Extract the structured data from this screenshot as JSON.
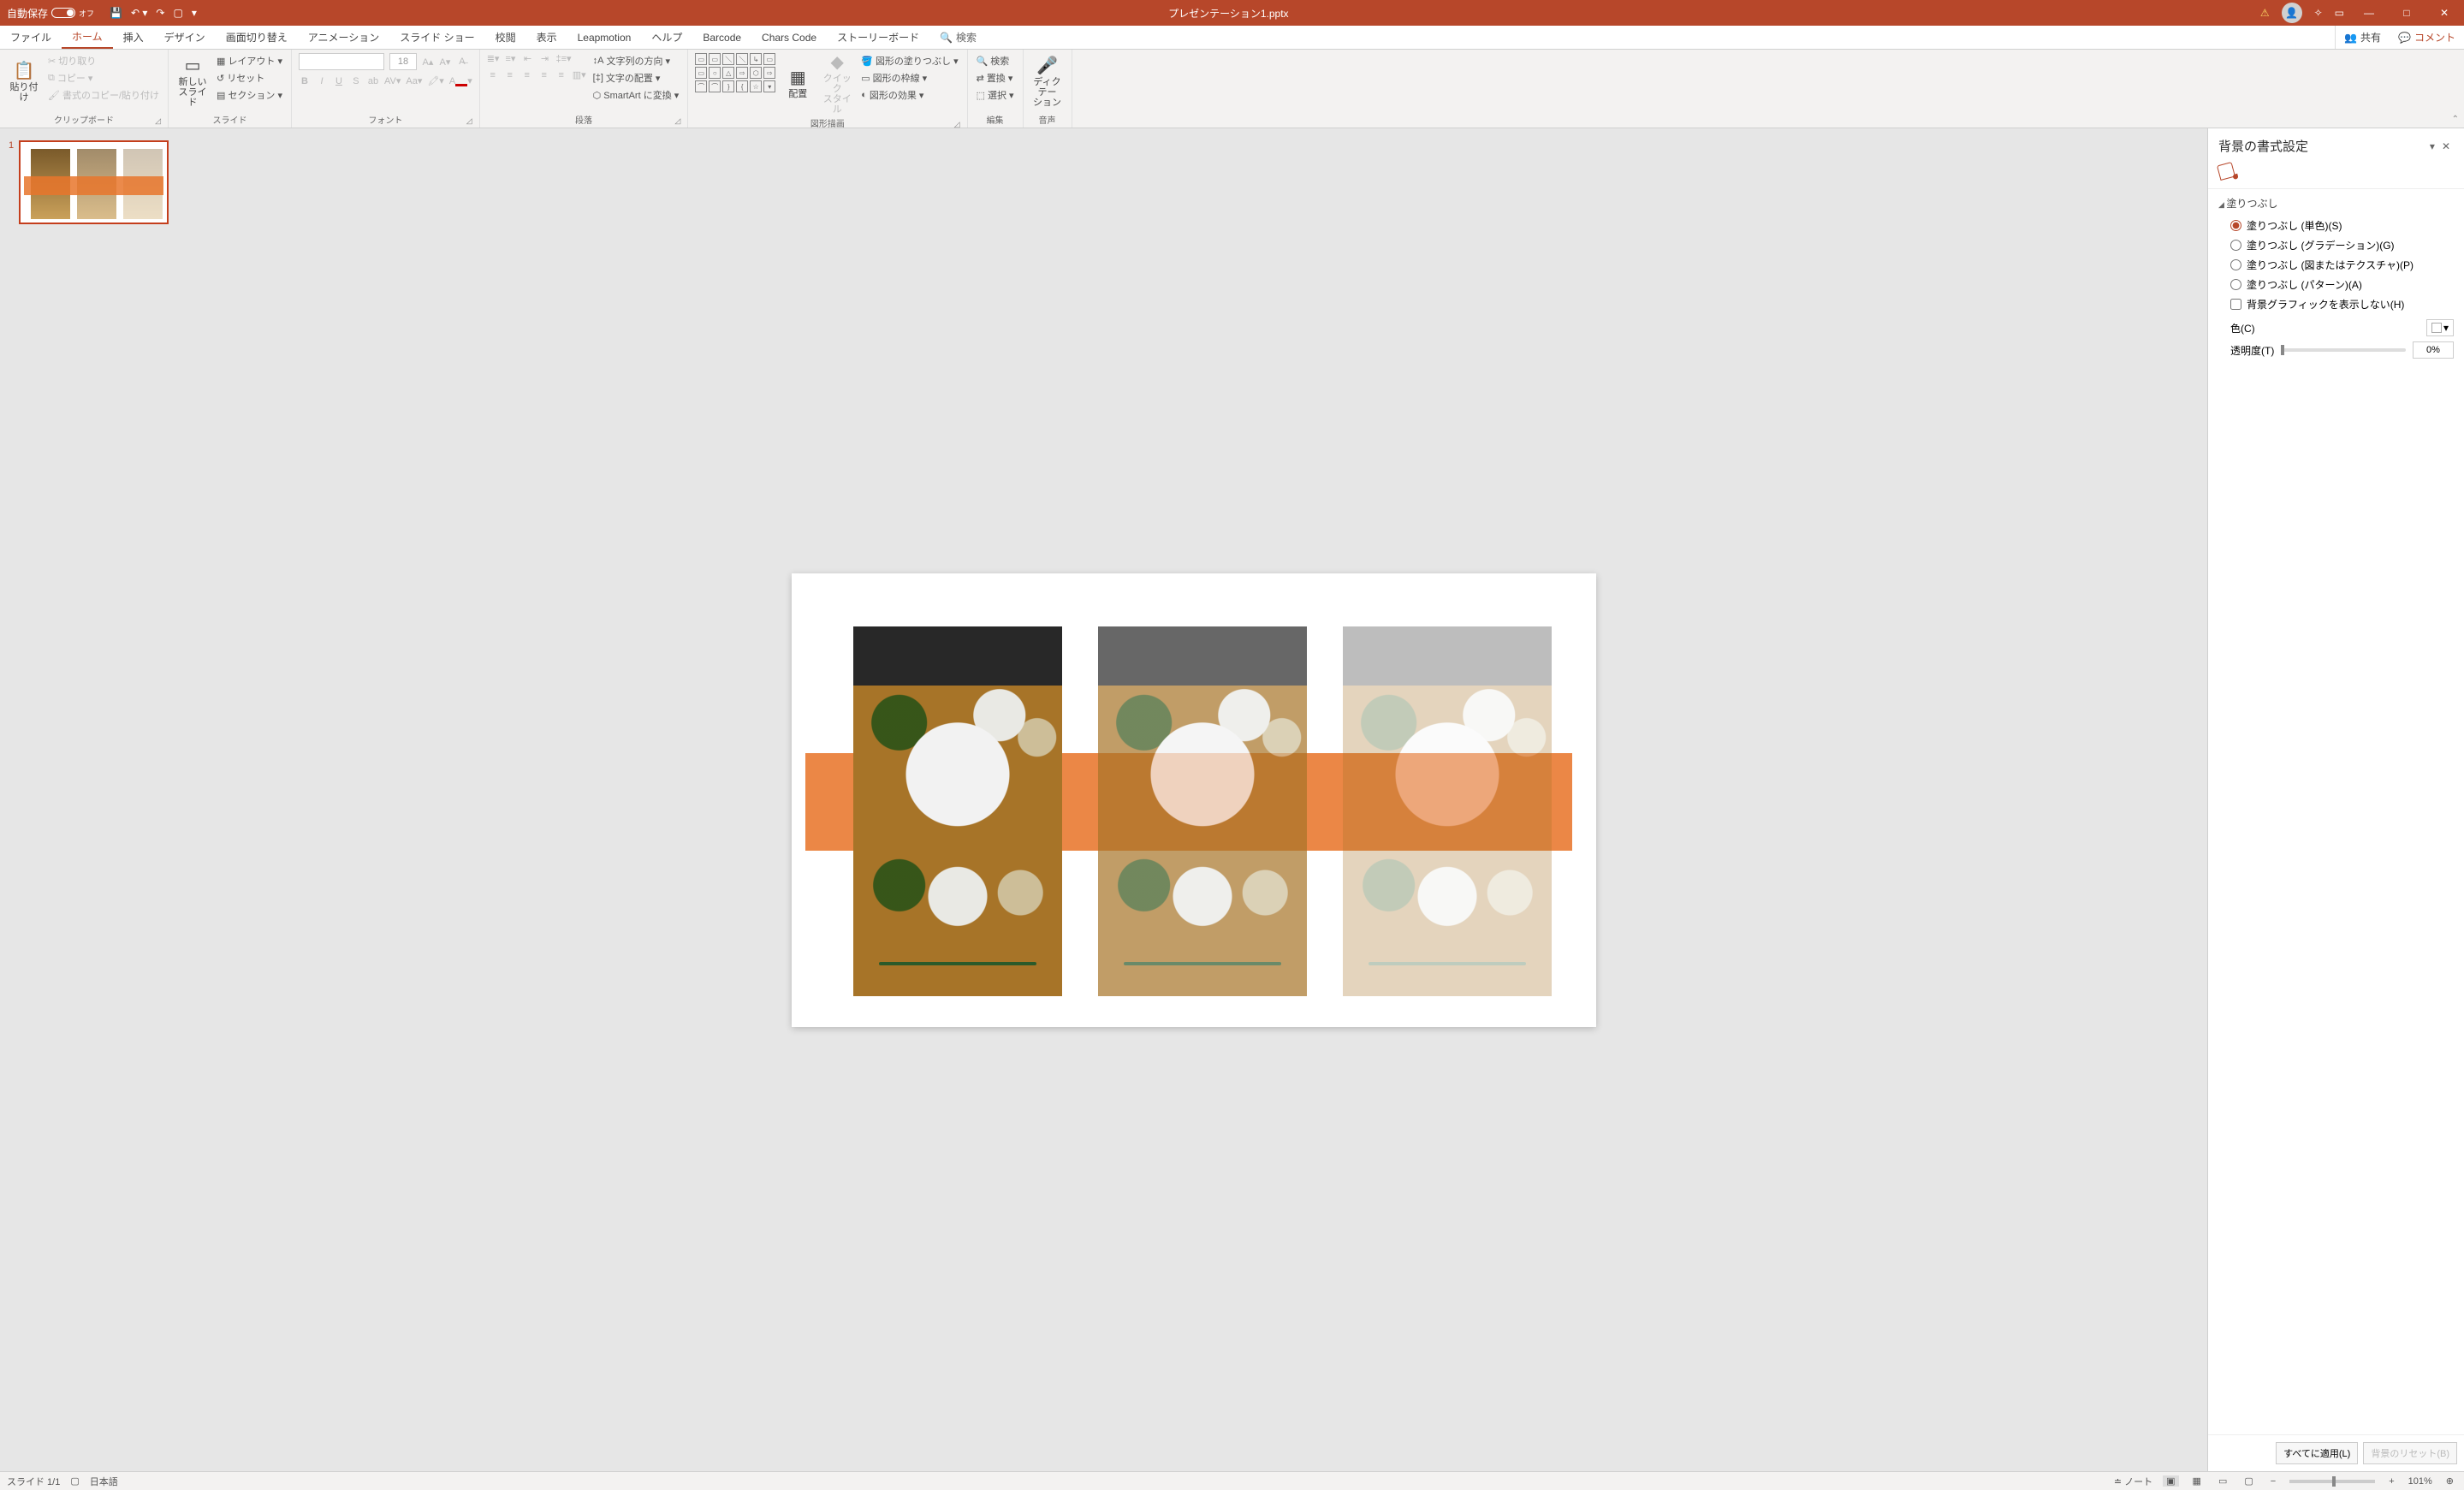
{
  "title_bar": {
    "autosave_label": "自動保存",
    "autosave_state": "オフ",
    "document_title": "プレゼンテーション1.pptx"
  },
  "tabs": {
    "file": "ファイル",
    "home": "ホーム",
    "insert": "挿入",
    "design": "デザイン",
    "transitions": "画面切り替え",
    "animations": "アニメーション",
    "slideshow": "スライド ショー",
    "review": "校閲",
    "view": "表示",
    "leapmotion": "Leapmotion",
    "help": "ヘルプ",
    "barcode": "Barcode",
    "charscode": "Chars Code",
    "storyboard": "ストーリーボード",
    "search": "検索",
    "share": "共有",
    "comment": "コメント"
  },
  "ribbon": {
    "clipboard": {
      "paste": "貼り付け",
      "cut": "切り取り",
      "copy": "コピー",
      "format_painter": "書式のコピー/貼り付け",
      "label": "クリップボード"
    },
    "slides": {
      "new_slide": "新しい\nスライド",
      "layout": "レイアウト",
      "reset": "リセット",
      "section": "セクション",
      "label": "スライド"
    },
    "font": {
      "size": "18",
      "label": "フォント"
    },
    "paragraph": {
      "text_direction": "文字列の方向",
      "text_align": "文字の配置",
      "smartart": "SmartArt に変換",
      "label": "段落"
    },
    "drawing": {
      "arrange": "配置",
      "quick_styles": "クイック\nスタイル",
      "shape_fill": "図形の塗りつぶし",
      "shape_outline": "図形の枠線",
      "shape_effects": "図形の効果",
      "label": "図形描画"
    },
    "editing": {
      "find": "検索",
      "replace": "置換",
      "select": "選択",
      "label": "編集"
    },
    "voice": {
      "dictate": "ディクテー\nション",
      "label": "音声"
    }
  },
  "thumbnails": {
    "slide1_number": "1"
  },
  "format_pane": {
    "title": "背景の書式設定",
    "fill_section": "塗りつぶし",
    "opt_solid": "塗りつぶし (単色)(S)",
    "opt_gradient": "塗りつぶし (グラデーション)(G)",
    "opt_picture": "塗りつぶし (図またはテクスチャ)(P)",
    "opt_pattern": "塗りつぶし (パターン)(A)",
    "opt_hide_bg": "背景グラフィックを表示しない(H)",
    "color_label": "色(C)",
    "transparency_label": "透明度(T)",
    "transparency_value": "0%",
    "apply_all": "すべてに適用(L)",
    "reset_bg": "背景のリセット(B)"
  },
  "status_bar": {
    "slide_info": "スライド 1/1",
    "language": "日本語",
    "notes": "ノート",
    "zoom": "101%"
  }
}
